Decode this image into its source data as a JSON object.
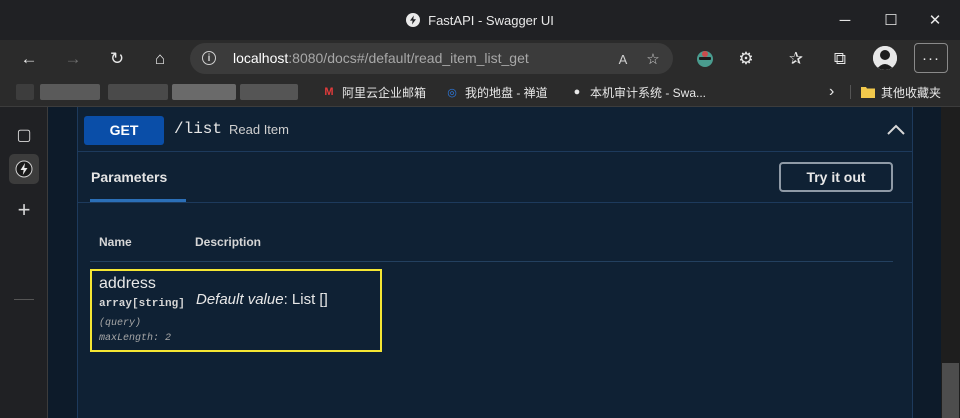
{
  "window": {
    "title": "FastAPI - Swagger UI",
    "controls": {
      "minimize": "─",
      "maximize": "☐",
      "close": "✕"
    }
  },
  "toolbar": {
    "url_host": "localhost",
    "url_rest": ":8080/docs#/default/read_item_list_get",
    "back_icon": "←",
    "forward_icon": "→",
    "reload_icon": "↻",
    "home_icon": "⌂",
    "info_icon": "i",
    "read_aloud_icon": "A",
    "favorite_icon": "☆",
    "extensions_icon": "⚙",
    "favorites_icon": "✰",
    "collections_icon": "⧉",
    "more_icon": "···"
  },
  "bookmarks": {
    "items": [
      {
        "label": "阿里云企业邮箱",
        "icon": "M",
        "color": "#e23b3b"
      },
      {
        "label": "我的地盘 - 禅道",
        "icon": "◎",
        "color": "#2c7be5"
      },
      {
        "label": "本机审计系统 - Swa...",
        "icon": "●",
        "color": "#e8e8e8"
      }
    ],
    "overflow_icon": "›",
    "other_folder": "其他收藏夹"
  },
  "sidebar": {
    "tabs_icon": "▢",
    "active_icon": "⚡",
    "add_icon": "+"
  },
  "operation": {
    "method": "GET",
    "path": "/list",
    "summary": "Read Item",
    "collapse_icon": "chevron-up-icon"
  },
  "parameters": {
    "tab_label": "Parameters",
    "try_button": "Try it out",
    "col_name": "Name",
    "col_description": "Description",
    "items": [
      {
        "name": "address",
        "type": "array[string]",
        "in": "(query)",
        "meta": "maxLength: 2",
        "default_label": "Default value",
        "default_value": ": List []"
      }
    ]
  },
  "colors": {
    "get_method": "#0a4ea8",
    "highlight": "#f5e633",
    "page_bg": "#0d1b2a"
  }
}
